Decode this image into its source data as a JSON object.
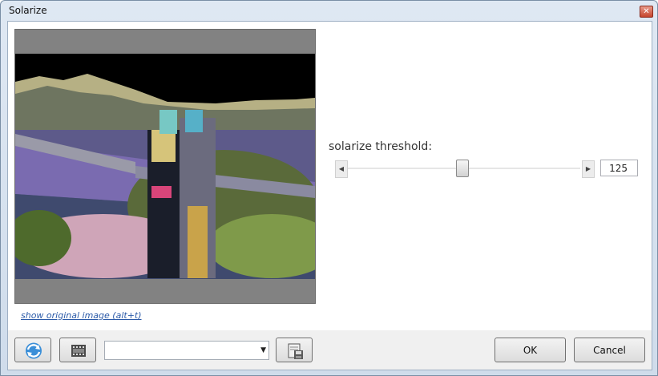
{
  "window": {
    "title": "Solarize",
    "close_icon": "close-icon"
  },
  "preview": {
    "show_original_label": "show original image (alt+t)"
  },
  "parameter": {
    "label": "solarize threshold:",
    "value": "125",
    "min": 0,
    "max": 255,
    "fraction": 0.49
  },
  "toolbar": {
    "refresh_icon": "refresh-icon",
    "film_icon": "film-strip-icon",
    "preset_value": "",
    "save_icon": "save-preset-icon",
    "ok_label": "OK",
    "cancel_label": "Cancel"
  }
}
